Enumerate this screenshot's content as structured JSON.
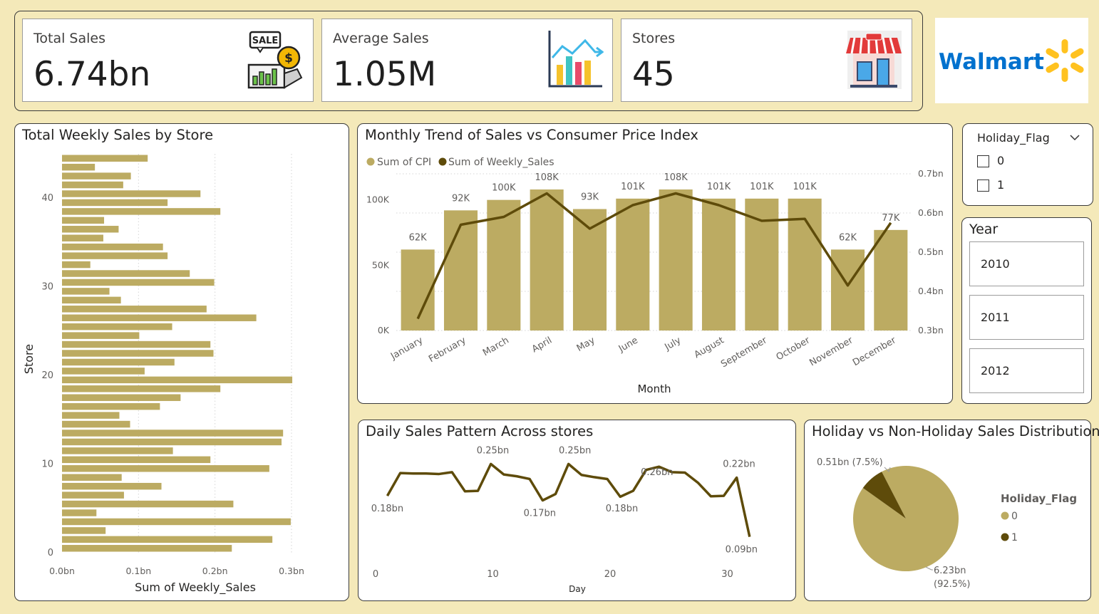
{
  "kpis": {
    "total_sales": {
      "label": "Total Sales",
      "value": "6.74bn",
      "icon": "sale-icon"
    },
    "average_sales": {
      "label": "Average Sales",
      "value": "1.05M",
      "icon": "bar-chart-icon"
    },
    "stores": {
      "label": "Stores",
      "value": "45",
      "icon": "shop-icon"
    }
  },
  "logo": {
    "text": "Walmart",
    "icon": "walmart-spark-icon",
    "colors": {
      "text": "#0071ce",
      "spark": "#ffc220"
    }
  },
  "colors": {
    "cpi": "#bcab62",
    "weekly_sales": "#5e4b0a",
    "background": "#f4e9b9",
    "holiday_0": "#bcab62",
    "holiday_1": "#5e4b0a"
  },
  "holiday_slicer": {
    "title": "Holiday_Flag",
    "options": [
      "0",
      "1"
    ],
    "icon": "chevron-down-icon"
  },
  "year_slicer": {
    "title": "Year",
    "options": [
      "2010",
      "2011",
      "2012"
    ]
  },
  "chart_data": [
    {
      "id": "store",
      "type": "bar",
      "orientation": "horizontal",
      "title": "Total Weekly Sales by Store",
      "xlabel": "Sum of Weekly_Sales",
      "ylabel": "Store",
      "xlim": [
        0,
        0.3
      ],
      "x_ticks": [
        "0.0bn",
        "0.1bn",
        "0.2bn",
        "0.3bn"
      ],
      "x_tick_values": [
        0,
        0.1,
        0.2,
        0.3
      ],
      "y_ticks": [
        "0",
        "10",
        "20",
        "30",
        "40"
      ],
      "y_tick_values": [
        0,
        10,
        20,
        30,
        40
      ],
      "ylim": [
        0,
        45
      ],
      "grid": true,
      "categories": [
        1,
        2,
        3,
        4,
        5,
        6,
        7,
        8,
        9,
        10,
        11,
        12,
        13,
        14,
        15,
        16,
        17,
        18,
        19,
        20,
        21,
        22,
        23,
        24,
        25,
        26,
        27,
        28,
        29,
        30,
        31,
        32,
        33,
        34,
        35,
        36,
        37,
        38,
        39,
        40,
        41,
        42,
        43,
        44,
        45
      ],
      "values": [
        0.222,
        0.275,
        0.057,
        0.299,
        0.045,
        0.224,
        0.081,
        0.13,
        0.078,
        0.271,
        0.194,
        0.145,
        0.287,
        0.289,
        0.089,
        0.075,
        0.128,
        0.155,
        0.207,
        0.301,
        0.108,
        0.147,
        0.198,
        0.194,
        0.101,
        0.144,
        0.254,
        0.189,
        0.077,
        0.062,
        0.199,
        0.167,
        0.037,
        0.138,
        0.132,
        0.054,
        0.074,
        0.055,
        0.207,
        0.138,
        0.181,
        0.08,
        0.09,
        0.043,
        0.112
      ]
    },
    {
      "id": "monthly",
      "type": "bar",
      "title": "Monthly Trend of Sales vs Consumer Price Index",
      "xlabel": "Month",
      "legend": [
        "Sum of CPI",
        "Sum of Weekly_Sales"
      ],
      "legend_position": "top-left",
      "categories": [
        "January",
        "February",
        "March",
        "April",
        "May",
        "June",
        "July",
        "August",
        "September",
        "October",
        "November",
        "December"
      ],
      "series": [
        {
          "name": "Sum of CPI",
          "type": "bar",
          "axis": "left",
          "values": [
            62,
            92,
            100,
            108,
            93,
            101,
            108,
            101,
            101,
            101,
            62,
            77
          ],
          "labels": [
            "62K",
            "92K",
            "100K",
            "108K",
            "93K",
            "101K",
            "108K",
            "101K",
            "101K",
            "101K",
            "62K",
            "77K"
          ]
        },
        {
          "name": "Sum of Weekly_Sales",
          "type": "line",
          "axis": "right",
          "values": [
            0.33,
            0.57,
            0.59,
            0.65,
            0.56,
            0.62,
            0.65,
            0.62,
            0.58,
            0.585,
            0.415,
            0.575
          ]
        }
      ],
      "ylim_left": [
        0,
        120
      ],
      "left_ticks": [
        "0K",
        "50K",
        "100K"
      ],
      "left_tick_values": [
        0,
        50,
        100
      ],
      "ylim_right": [
        0.3,
        0.7
      ],
      "right_ticks": [
        "0.3bn",
        "0.4bn",
        "0.5bn",
        "0.6bn",
        "0.7bn"
      ],
      "right_tick_values": [
        0.3,
        0.4,
        0.5,
        0.6,
        0.7
      ],
      "grid": true
    },
    {
      "id": "daily",
      "type": "line",
      "title": "Daily Sales Pattern Across stores",
      "xlabel": "Day",
      "x": [
        1,
        2,
        3,
        4,
        5,
        6,
        7,
        8,
        9,
        10,
        11,
        12,
        13,
        14,
        15,
        16,
        17,
        18,
        19,
        20,
        21,
        22,
        23,
        24,
        25,
        26,
        27,
        28,
        29,
        30,
        31
      ],
      "values": [
        0.18,
        0.23,
        0.229,
        0.229,
        0.228,
        0.232,
        0.19,
        0.191,
        0.25,
        0.227,
        0.223,
        0.217,
        0.17,
        0.184,
        0.25,
        0.226,
        0.221,
        0.217,
        0.178,
        0.191,
        0.237,
        0.244,
        0.232,
        0.231,
        0.209,
        0.179,
        0.18,
        0.22,
        0.09
      ],
      "x_values_note_skip": [],
      "xlim": [
        0,
        31
      ],
      "x_ticks": [
        "0",
        "10",
        "20",
        "30"
      ],
      "x_tick_values": [
        0,
        10,
        20,
        30
      ],
      "ylim": [
        0.08,
        0.26
      ],
      "labels": [
        {
          "day": 1,
          "value": 0.18,
          "text": "0.18bn",
          "pos": "below"
        },
        {
          "day": 10,
          "value": 0.25,
          "text": "0.25bn",
          "pos": "above"
        },
        {
          "day": 14,
          "value": 0.17,
          "text": "0.17bn",
          "pos": "below"
        },
        {
          "day": 17,
          "value": 0.25,
          "text": "0.25bn",
          "pos": "above"
        },
        {
          "day": 21,
          "value": 0.18,
          "text": "0.18bn",
          "pos": "below"
        },
        {
          "day": 24,
          "value": 0.26,
          "text": "0.26bn",
          "pos": "below"
        },
        {
          "day": 31,
          "value": 0.22,
          "text": "0.22bn",
          "pos": "above"
        },
        {
          "day": 32,
          "value": 0.09,
          "text": "0.09bn",
          "pos": "below"
        }
      ]
    },
    {
      "id": "holiday",
      "type": "pie",
      "title": "Holiday vs Non-Holiday Sales Distribution",
      "legend_title": "Holiday_Flag",
      "legend_position": "right",
      "slices": [
        {
          "name": "0",
          "value": 6.23,
          "label": "6.23bn",
          "pct": "(92.5%)"
        },
        {
          "name": "1",
          "value": 0.51,
          "label": "0.51bn (7.5%)",
          "pct": ""
        }
      ]
    }
  ]
}
